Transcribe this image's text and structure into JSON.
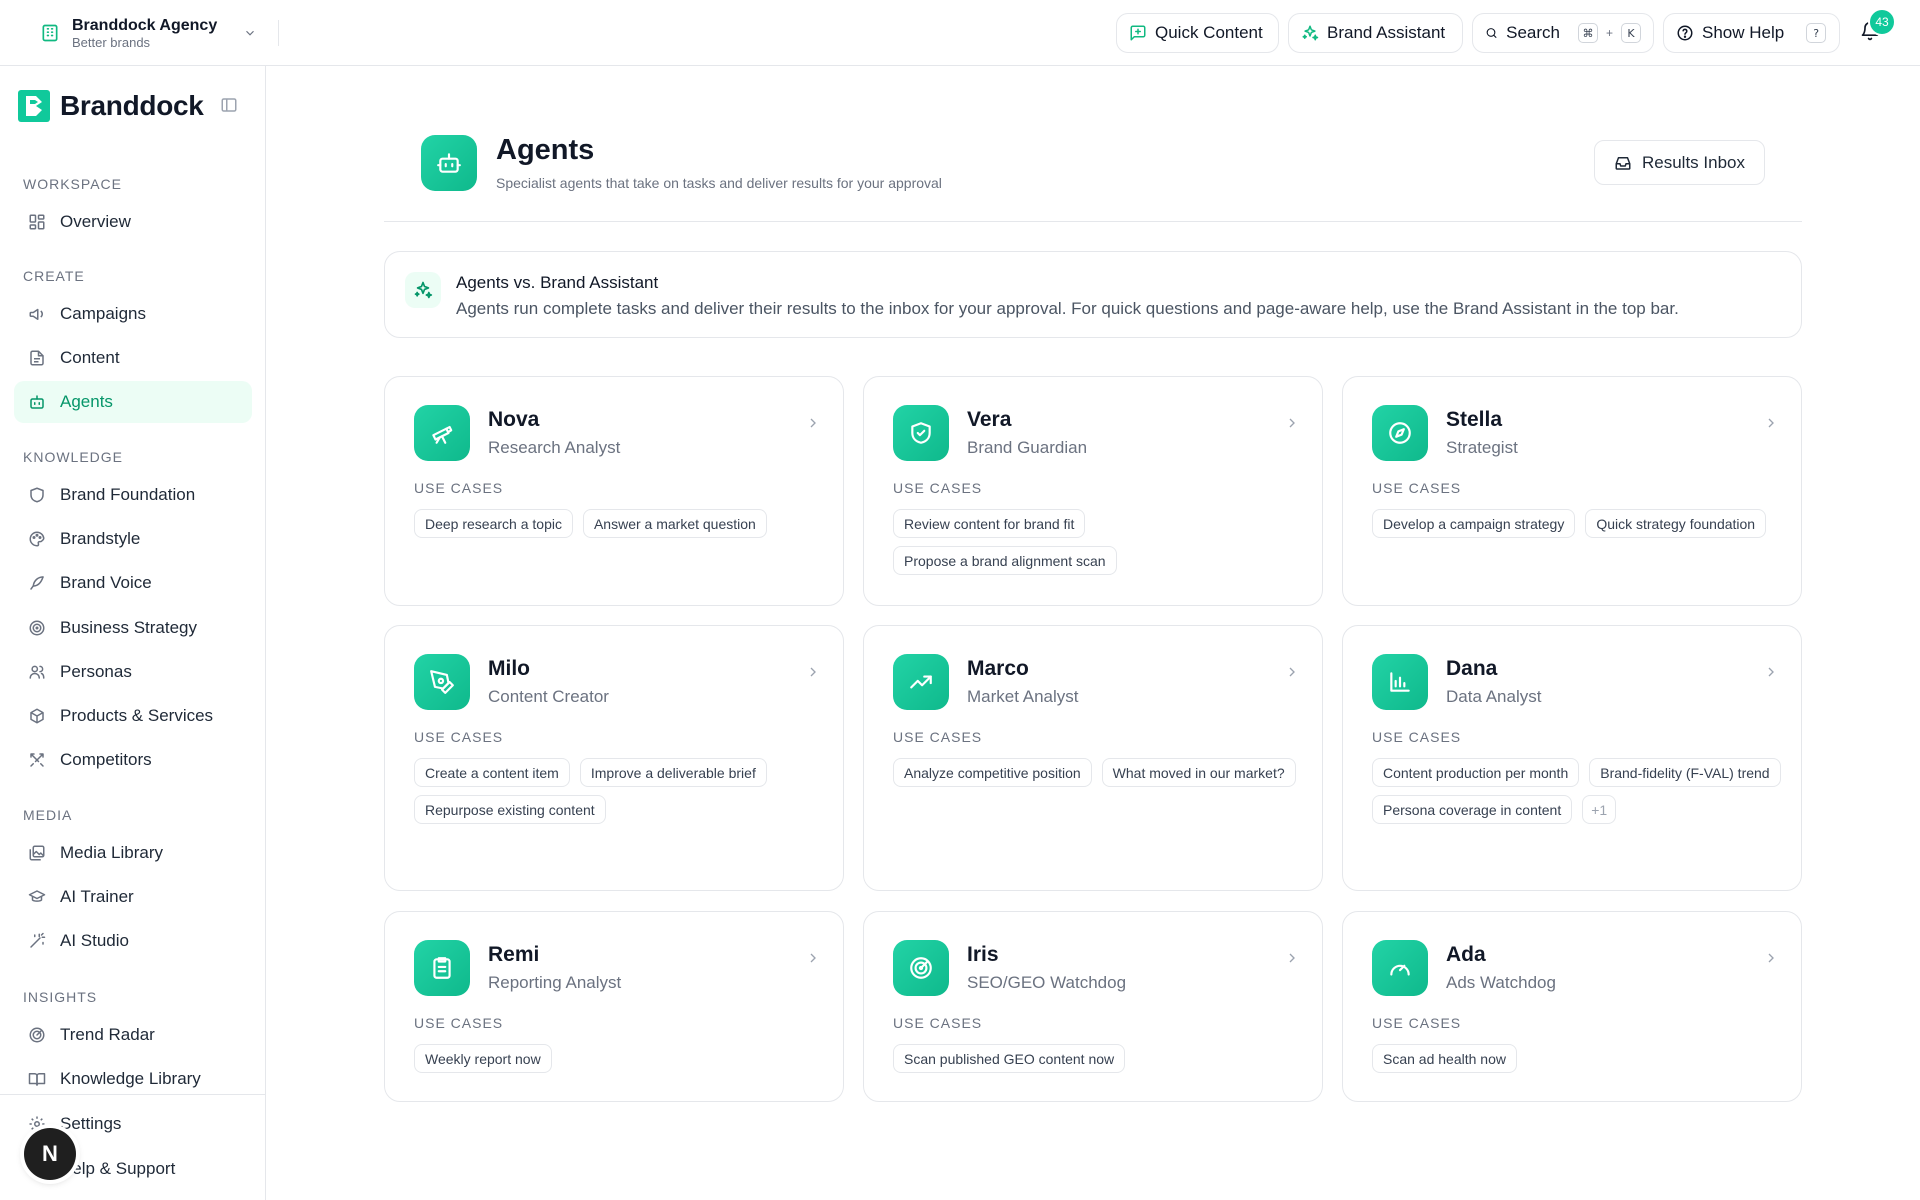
{
  "topbar": {
    "workspace_name": "Branddock Agency",
    "workspace_sub": "Better brands",
    "quick_content": "Quick Content",
    "brand_assistant": "Brand Assistant",
    "search": "Search",
    "search_key_mod": "⌘",
    "search_key_plus": "+",
    "search_key": "K",
    "show_help": "Show Help",
    "help_key": "?",
    "notifications_count": "43"
  },
  "sidebar": {
    "brand": "Branddock",
    "sections": {
      "workspace": "WORKSPACE",
      "create": "CREATE",
      "knowledge": "KNOWLEDGE",
      "media": "MEDIA",
      "insights": "INSIGHTS"
    },
    "items": {
      "overview": "Overview",
      "campaigns": "Campaigns",
      "content": "Content",
      "agents": "Agents",
      "brand_foundation": "Brand Foundation",
      "brandstyle": "Brandstyle",
      "brand_voice": "Brand Voice",
      "business_strategy": "Business Strategy",
      "personas": "Personas",
      "products_services": "Products & Services",
      "competitors": "Competitors",
      "media_library": "Media Library",
      "ai_trainer": "AI Trainer",
      "ai_studio": "AI Studio",
      "trend_radar": "Trend Radar",
      "knowledge_library": "Knowledge Library",
      "settings": "Settings",
      "help_support": "Help & Support"
    },
    "avatar_letter": "N"
  },
  "main": {
    "title": "Agents",
    "subtitle": "Specialist agents that take on tasks and deliver results for your approval",
    "results_inbox": "Results Inbox",
    "info_title": "Agents vs. Brand Assistant",
    "info_text": "Agents run complete tasks and deliver their results to the inbox for your approval. For quick questions and page-aware help, use the Brand Assistant in the top bar.",
    "use_cases_label": "USE CASES",
    "agents": [
      {
        "name": "Nova",
        "role": "Research Analyst",
        "icon": "telescope-icon",
        "chips": [
          "Deep research a topic",
          "Answer a market question"
        ]
      },
      {
        "name": "Vera",
        "role": "Brand Guardian",
        "icon": "shield-check-icon",
        "chips": [
          "Review content for brand fit",
          "Propose a brand alignment scan"
        ]
      },
      {
        "name": "Stella",
        "role": "Strategist",
        "icon": "compass-icon",
        "chips": [
          "Develop a campaign strategy",
          "Quick strategy foundation"
        ]
      },
      {
        "name": "Milo",
        "role": "Content Creator",
        "icon": "pen-tool-icon",
        "chips": [
          "Create a content item",
          "Improve a deliverable brief",
          "Repurpose existing content"
        ]
      },
      {
        "name": "Marco",
        "role": "Market Analyst",
        "icon": "trending-up-icon",
        "chips": [
          "Analyze competitive position",
          "What moved in our market?"
        ]
      },
      {
        "name": "Dana",
        "role": "Data Analyst",
        "icon": "bar-chart-icon",
        "chips": [
          "Content production per month",
          "Brand-fidelity (F-VAL) trend",
          "Persona coverage in content"
        ],
        "more": "+1"
      },
      {
        "name": "Remi",
        "role": "Reporting Analyst",
        "icon": "clipboard-list-icon",
        "chips": [
          "Weekly report now"
        ]
      },
      {
        "name": "Iris",
        "role": "SEO/GEO Watchdog",
        "icon": "radar-icon",
        "chips": [
          "Scan published GEO content now"
        ]
      },
      {
        "name": "Ada",
        "role": "Ads Watchdog",
        "icon": "gauge-icon",
        "chips": [
          "Scan ad health now"
        ]
      }
    ]
  },
  "colors": {
    "accent": "#10c99b",
    "accent_dark": "#059669",
    "active_bg": "#ecfdf5"
  }
}
